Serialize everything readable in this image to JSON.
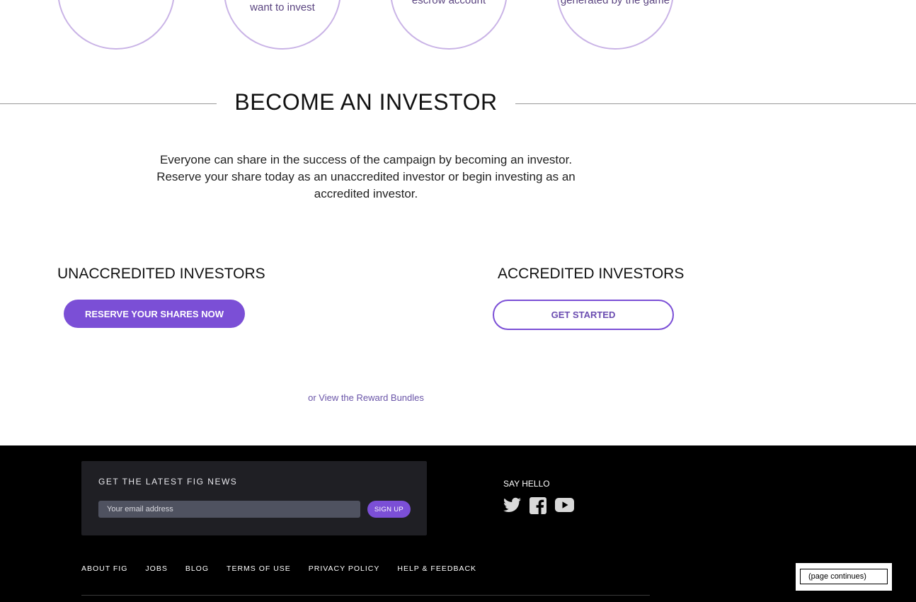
{
  "steps": [
    {
      "text": ""
    },
    {
      "text": "want to invest"
    },
    {
      "text": "escrow account"
    },
    {
      "text": "generated by the game"
    }
  ],
  "become_investor": {
    "title": "BECOME AN INVESTOR",
    "intro": "Everyone can share in the success of the campaign by becoming an investor. Reserve your share today as an unaccredited investor or begin investing as an accredited investor."
  },
  "unaccredited": {
    "heading": "UNACCREDITED INVESTORS",
    "button_label": "RESERVE YOUR SHARES NOW"
  },
  "accredited": {
    "heading": "ACCREDITED INVESTORS",
    "button_label": "GET STARTED"
  },
  "reward_link": "or View the Reward Bundles",
  "footer": {
    "newsletter": {
      "title": "GET THE LATEST FIG NEWS",
      "email_placeholder": "Your email address",
      "signup_label": "SIGN UP"
    },
    "say_hello": "SAY HELLO",
    "social_icons": [
      "twitter-icon",
      "facebook-icon",
      "youtube-icon"
    ],
    "nav": [
      "ABOUT FIG",
      "JOBS",
      "BLOG",
      "TERMS OF USE",
      "PRIVACY POLICY",
      "HELP & FEEDBACK"
    ]
  },
  "page_continues": "(page continues)",
  "colors": {
    "accent": "#7b4fd6",
    "circle_border": "#c9b3e6",
    "footer_bg": "#000000",
    "newsletter_bg": "#1f1f24"
  }
}
